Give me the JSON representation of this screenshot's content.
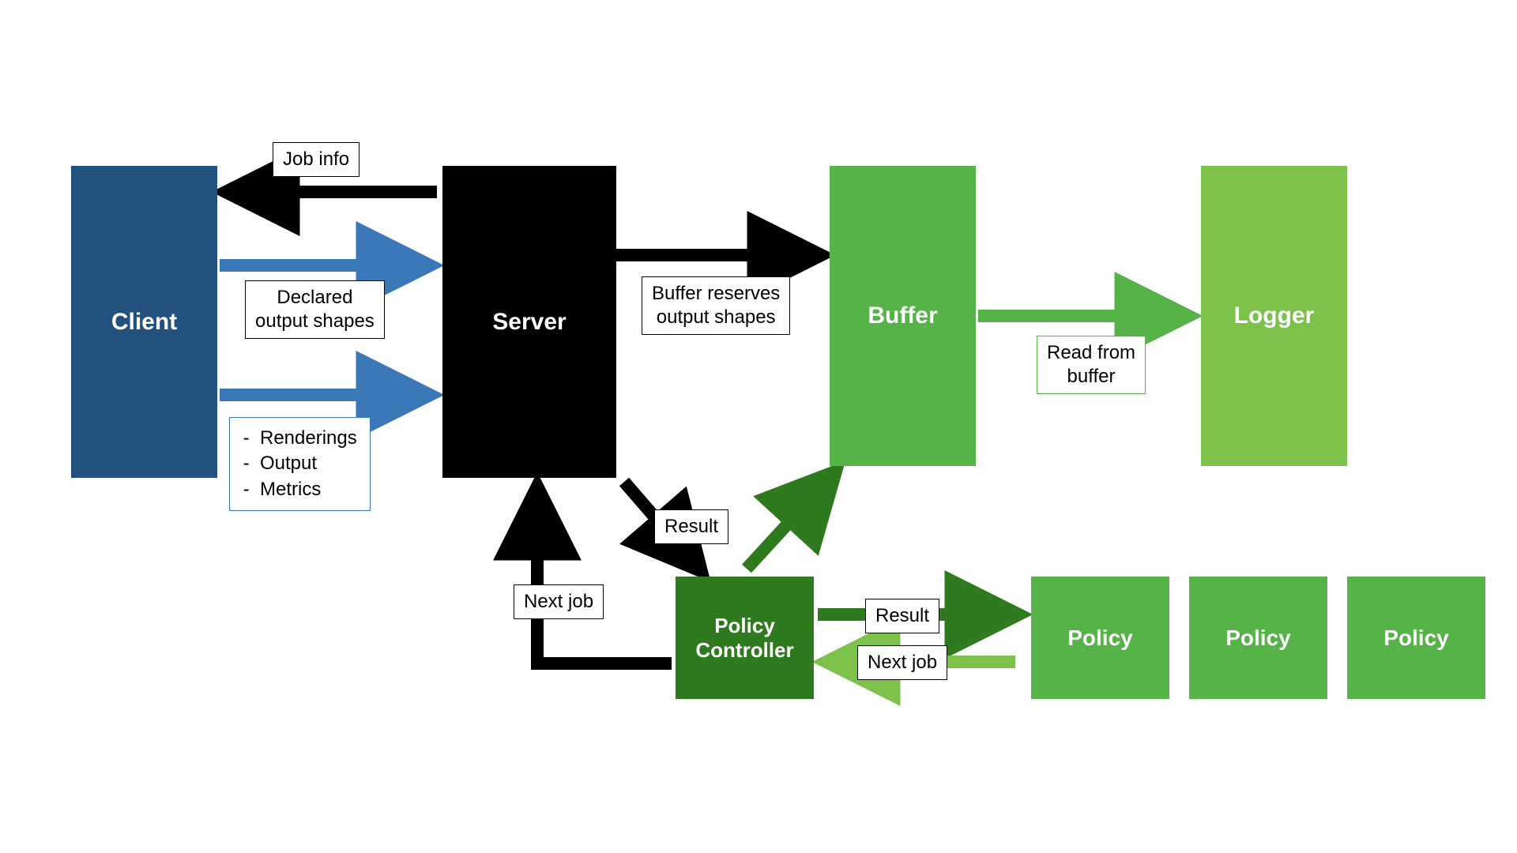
{
  "colors": {
    "blue": "#22517e",
    "blueArrow": "#3a78b8",
    "black": "#000000",
    "green1": "#56b347",
    "green2": "#7cc24a",
    "greenDark": "#2f7a1f",
    "greenMid": "#3c8f2a"
  },
  "nodes": {
    "client": "Client",
    "server": "Server",
    "buffer": "Buffer",
    "logger": "Logger",
    "policyController": "Policy\nController",
    "policy": "Policy"
  },
  "labels": {
    "jobInfo": "Job info",
    "declared": "Declared\noutput shapes",
    "renderings": [
      "Renderings",
      "Output",
      "Metrics"
    ],
    "bufferReserves": "Buffer reserves\noutput shapes",
    "readFromBuffer": "Read from\nbuffer",
    "result": "Result",
    "nextJob": "Next job"
  }
}
